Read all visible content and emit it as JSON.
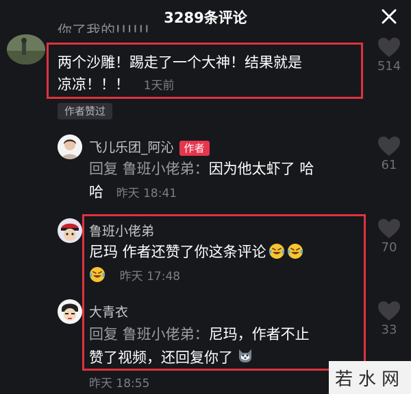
{
  "header": {
    "title": "3289条评论"
  },
  "partial_top_text": "你了我的!!!!!!",
  "comments": [
    {
      "text": "两个沙雕！踢走了一个大神！结果就是凉凉！！！",
      "line1": "两个沙雕！踢走了一个大神！结果就是",
      "line2": "凉凉！！！",
      "time": "1天前",
      "likes": "514",
      "badge": "作者赞过"
    },
    {
      "user": "飞儿乐团_阿沁",
      "author_badge": "作者",
      "reply_prefix": "回复 鲁班小佬弟：",
      "line1_rest": "因为他太虾了 哈",
      "line2": "哈",
      "time": "昨天 18:41",
      "likes": "61"
    },
    {
      "user": "鲁班小佬弟",
      "line1": "尼玛 作者还赞了你这条评论",
      "time": "昨天 17:48",
      "likes": "70"
    },
    {
      "user": "大青衣",
      "reply_prefix": "回复 鲁班小佬弟：",
      "line1_rest": "尼玛，作者不止",
      "line2": "赞了视频，还回复你了",
      "time": "昨天 18:55",
      "likes": "33"
    }
  ],
  "watermark": "若水网",
  "colors": {
    "background": "#17181c",
    "highlight_box": "#e0323e",
    "author_badge": "#e5364e"
  }
}
